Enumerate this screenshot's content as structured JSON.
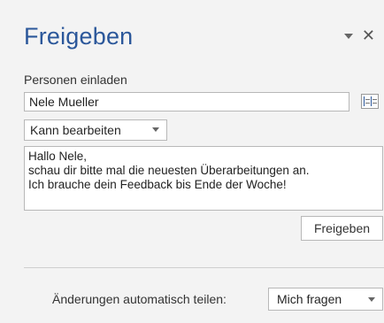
{
  "pane": {
    "title": "Freigeben",
    "accent_color": "#2b579a",
    "controls": {
      "options_icon": "chevron-down-icon",
      "close_icon": "close-icon",
      "close_glyph": "✕"
    }
  },
  "invite": {
    "label": "Personen einladen",
    "name_value": "Nele Mueller",
    "addressbook_icon": "address-book-icon"
  },
  "permission": {
    "selected": "Kann bearbeiten"
  },
  "message": {
    "text": "Hallo Nele,\nschau dir bitte mal die neuesten Überarbeitungen an.\nIch brauche dein Feedback bis Ende der Woche!"
  },
  "share_button": {
    "label": "Freigeben"
  },
  "auto_share": {
    "label": "Änderungen automatisch teilen:",
    "selected": "Mich fragen"
  }
}
